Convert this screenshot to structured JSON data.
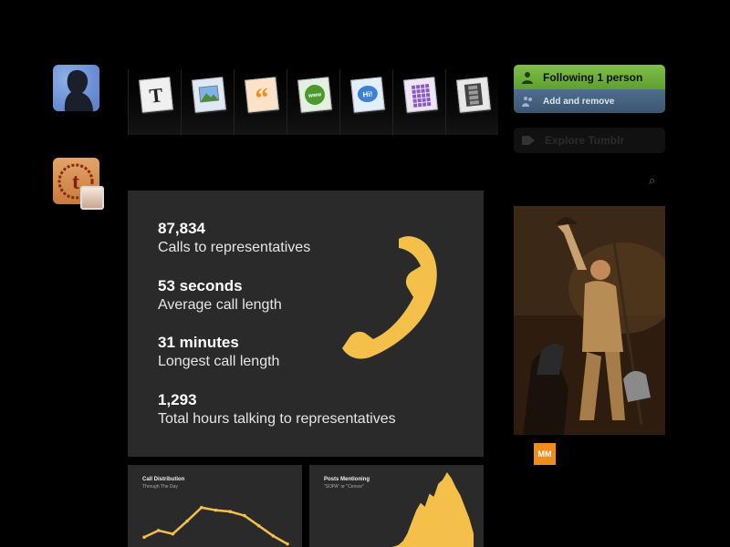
{
  "header": {
    "post_types": [
      {
        "name": "text-post-icon",
        "glyph": "T"
      },
      {
        "name": "photo-post-icon",
        "glyph": ""
      },
      {
        "name": "quote-post-icon",
        "glyph": "“"
      },
      {
        "name": "link-post-icon",
        "glyph": "www"
      },
      {
        "name": "chat-post-icon",
        "glyph": "Hi!"
      },
      {
        "name": "audio-post-icon",
        "glyph": ""
      },
      {
        "name": "video-post-icon",
        "glyph": ""
      }
    ]
  },
  "sidebar": {
    "following_label": "Following 1 person",
    "add_remove_label": "Add and remove",
    "explore_label": "Explore Tumblr",
    "search_glyph": "⌕",
    "badge_text": "MM"
  },
  "stats": [
    {
      "value": "87,834",
      "label": "Calls to representatives"
    },
    {
      "value": "53 seconds",
      "label": "Average call length"
    },
    {
      "value": "31 minutes",
      "label": "Longest call length"
    },
    {
      "value": "1,293",
      "label": "Total hours talking to representatives"
    }
  ],
  "charts": {
    "left": {
      "title": "Call Distribution",
      "subtitle": "Through The Day"
    },
    "right": {
      "title": "Posts Mentioning",
      "subtitle": "\"SOPA\" or \"Censor\""
    }
  },
  "chart_data": [
    {
      "type": "line",
      "title": "Call Distribution",
      "subtitle": "Through The Day",
      "x": [
        1,
        2,
        3,
        4,
        5,
        6,
        7,
        8,
        9,
        10,
        11
      ],
      "values": [
        28,
        38,
        33,
        52,
        72,
        68,
        66,
        60,
        45,
        30,
        18
      ],
      "ylim": [
        0,
        100
      ]
    },
    {
      "type": "area",
      "title": "Posts Mentioning",
      "subtitle": "\"SOPA\" or \"Censor\"",
      "x": [
        1,
        2,
        3,
        4,
        5,
        6,
        7,
        8,
        9,
        10,
        11,
        12,
        13,
        14,
        15,
        16,
        17,
        18,
        19,
        20
      ],
      "values": [
        2,
        3,
        5,
        10,
        20,
        35,
        50,
        60,
        55,
        72,
        68,
        85,
        90,
        100,
        92,
        80,
        70,
        55,
        40,
        20
      ],
      "ylim": [
        0,
        100
      ]
    }
  ],
  "colors": {
    "accent_yellow": "#f4c04a",
    "card_bg": "#2a2a2a",
    "follow_green": "#6aad39",
    "follow_blue": "#45627f"
  }
}
